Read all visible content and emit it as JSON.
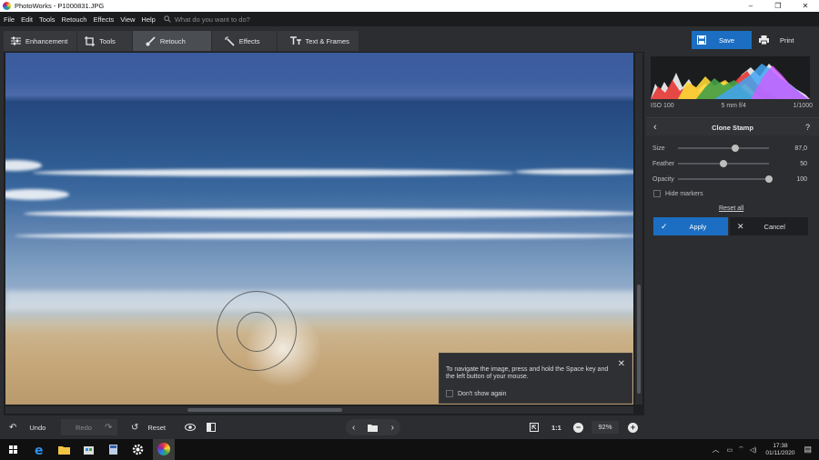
{
  "window": {
    "title": "PhotoWorks - P1000831.JPG",
    "controls": [
      "–",
      "❐",
      "✕"
    ]
  },
  "menu": {
    "items": [
      "File",
      "Edit",
      "Tools",
      "Retouch",
      "Effects",
      "View",
      "Help"
    ],
    "search_placeholder": "What do you want to do?"
  },
  "tabs": [
    {
      "label": "Enhancement",
      "icon": "sliders-icon"
    },
    {
      "label": "Tools",
      "icon": "crop-icon"
    },
    {
      "label": "Retouch",
      "icon": "brush-icon",
      "active": true
    },
    {
      "label": "Effects",
      "icon": "magic-wand-icon"
    },
    {
      "label": "Text & Frames",
      "icon": "text-icon"
    }
  ],
  "actions": {
    "save_label": "Save",
    "print_label": "Print"
  },
  "tooltip": {
    "message": "To navigate the image, press and hold the Space key and the left button of your mouse.",
    "dont_show": "Don't show again"
  },
  "bottombar": {
    "undo_label": "Undo",
    "redo_label": "Redo",
    "reset_label": "Reset",
    "one_to_one": "1:1",
    "zoom": "92%"
  },
  "panel": {
    "exif": {
      "iso": "ISO 100",
      "lens": "5 mm f/4",
      "shutter": "1/1000"
    },
    "title": "Clone Stamp",
    "help": "?",
    "sliders": [
      {
        "label": "Size",
        "value": "87,0",
        "fraction": 0.63
      },
      {
        "label": "Feather",
        "value": "50",
        "fraction": 0.5
      },
      {
        "label": "Opacity",
        "value": "100",
        "fraction": 1.0
      }
    ],
    "hide_markers": "Hide markers",
    "reset_all": "Reset all",
    "apply_label": "Apply",
    "cancel_label": "Cancel"
  },
  "taskbar": {
    "time": "17:38",
    "date": "01/11/2020"
  },
  "colors": {
    "accent": "#1b6ec2",
    "panel_bg": "#2b2d30",
    "menubar_bg": "#1b1c1e"
  }
}
